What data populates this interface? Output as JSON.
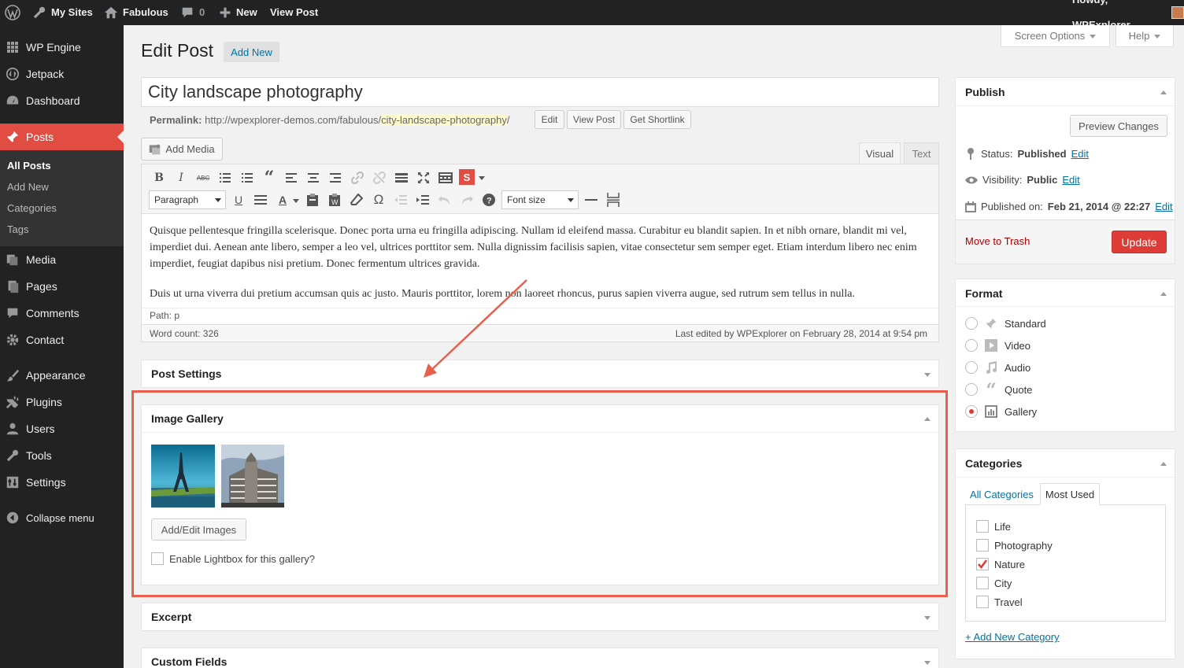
{
  "adminbar": {
    "my_sites": "My Sites",
    "site_name": "Fabulous",
    "comments_count": "0",
    "new_label": "New",
    "view_post": "View Post",
    "howdy": "Howdy, WPExplorer"
  },
  "sidebar": {
    "items": [
      {
        "label": "WP Engine",
        "icon": "grid-icon"
      },
      {
        "label": "Jetpack",
        "icon": "jetpack-icon"
      },
      {
        "label": "Dashboard",
        "icon": "dashboard-icon"
      },
      {
        "label": "Posts",
        "icon": "pin-icon"
      },
      {
        "label": "Media",
        "icon": "media-icon"
      },
      {
        "label": "Pages",
        "icon": "pages-icon"
      },
      {
        "label": "Comments",
        "icon": "comment-icon"
      },
      {
        "label": "Contact",
        "icon": "gear-icon"
      },
      {
        "label": "Appearance",
        "icon": "brush-icon"
      },
      {
        "label": "Plugins",
        "icon": "plug-icon"
      },
      {
        "label": "Users",
        "icon": "user-icon"
      },
      {
        "label": "Tools",
        "icon": "wrench-icon"
      },
      {
        "label": "Settings",
        "icon": "settings-icon"
      }
    ],
    "submenu": [
      "All Posts",
      "Add New",
      "Categories",
      "Tags"
    ],
    "collapse": "Collapse menu"
  },
  "screen_options": "Screen Options",
  "help": "Help",
  "page": {
    "title": "Edit Post",
    "add_new": "Add New"
  },
  "post": {
    "title": "City landscape photography",
    "permalink_label": "Permalink:",
    "permalink_base": "http://wpexplorer-demos.com/fabulous/",
    "permalink_slug": "city-landscape-photography",
    "permalink_end": "/",
    "edit_btn": "Edit",
    "view_post_btn": "View Post",
    "shortlink_btn": "Get Shortlink"
  },
  "editor": {
    "add_media": "Add Media",
    "tab_visual": "Visual",
    "tab_text": "Text",
    "format_select": "Paragraph",
    "font_size_select": "Font size",
    "paragraph1": "Quisque pellentesque fringilla scelerisque. Donec porta urna eu fringilla adipiscing. Nullam id eleifend massa. Curabitur eu blandit sapien. In et nibh ornare, blandit mi vel, imperdiet dui. Aenean ante libero, semper a leo vel, ultrices porttitor sem. Nulla dignissim facilisis sapien, vitae consectetur sem semper eget. Etiam interdum libero nec enim imperdiet, feugiat dapibus nisi pretium. Donec fermentum ultrices gravida.",
    "paragraph2": "Duis ut urna viverra dui pretium accumsan quis ac justo. Mauris porttitor, lorem non laoreet rhoncus, purus sapien viverra augue, sed rutrum sem tellus in nulla.",
    "path": "Path: p",
    "word_count": "Word count: 326",
    "last_edited": "Last edited by WPExplorer on February 28, 2014 at 9:54 pm"
  },
  "boxes": {
    "post_settings": "Post Settings",
    "image_gallery": "Image Gallery",
    "add_edit_images": "Add/Edit Images",
    "lightbox_label": "Enable Lightbox for this gallery?",
    "excerpt": "Excerpt",
    "custom_fields": "Custom Fields"
  },
  "publish": {
    "title": "Publish",
    "preview": "Preview Changes",
    "status_label": "Status:",
    "status_value": "Published",
    "visibility_label": "Visibility:",
    "visibility_value": "Public",
    "published_label": "Published on:",
    "published_value": "Feb 21, 2014 @ 22:27",
    "edit": "Edit",
    "trash": "Move to Trash",
    "update": "Update"
  },
  "format": {
    "title": "Format",
    "options": [
      "Standard",
      "Video",
      "Audio",
      "Quote",
      "Gallery"
    ],
    "selected": "Gallery"
  },
  "categories": {
    "title": "Categories",
    "tab_all": "All Categories",
    "tab_most_used": "Most Used",
    "items": [
      {
        "label": "Life",
        "checked": false
      },
      {
        "label": "Photography",
        "checked": false
      },
      {
        "label": "Nature",
        "checked": true
      },
      {
        "label": "City",
        "checked": false
      },
      {
        "label": "Travel",
        "checked": false
      }
    ],
    "add_new": "+ Add New Category"
  },
  "colors": {
    "accent": "#e14d43",
    "annotation": "#e8604c",
    "link": "#0074a2",
    "update_button": "#dd3d36"
  }
}
